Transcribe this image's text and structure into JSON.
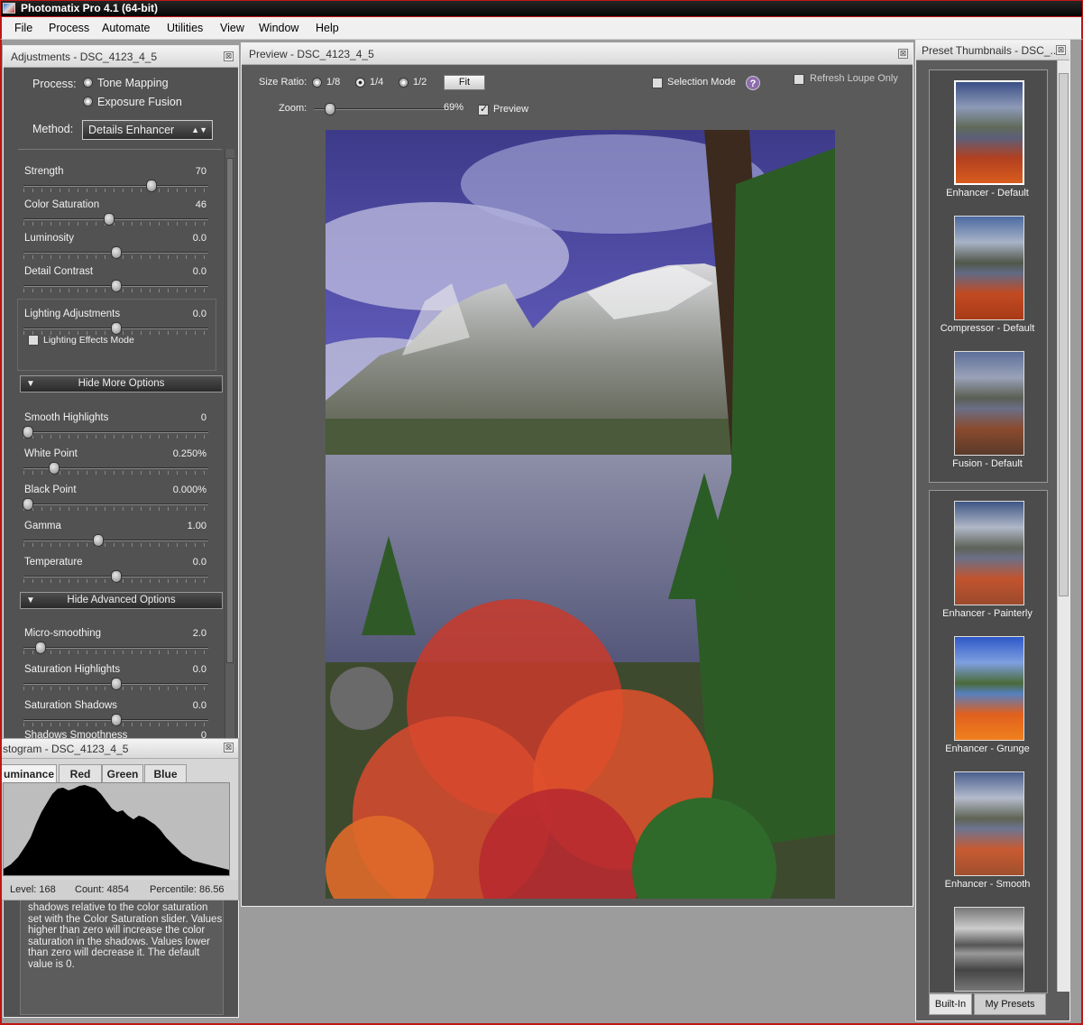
{
  "window": {
    "title": "Photomatix Pro 4.1 (64-bit)"
  },
  "menu": [
    "File",
    "Process",
    "Automate",
    "Utilities",
    "View",
    "Window",
    "Help"
  ],
  "adjustments": {
    "title": "Adjustments - DSC_4123_4_5",
    "process_label": "Process:",
    "process_options": [
      "Tone Mapping",
      "Exposure Fusion"
    ],
    "method_label": "Method:",
    "method_value": "Details Enhancer",
    "sliders": [
      {
        "label": "Strength",
        "value": "70",
        "level": 0.7
      },
      {
        "label": "Color Saturation",
        "value": "46",
        "level": 0.46
      },
      {
        "label": "Luminosity",
        "value": "0.0",
        "level": 0.5
      },
      {
        "label": "Detail Contrast",
        "value": "0.0",
        "level": 0.5
      }
    ],
    "lighting": {
      "label": "Lighting Adjustments",
      "value": "0.0",
      "level": 0.5,
      "checkbox": "Lighting Effects Mode"
    },
    "hide_more": "Hide More Options",
    "more_sliders": [
      {
        "label": "Smooth Highlights",
        "value": "0",
        "level": 0.0
      },
      {
        "label": "White Point",
        "value": "0.250%",
        "level": 0.15
      },
      {
        "label": "Black Point",
        "value": "0.000%",
        "level": 0.0
      },
      {
        "label": "Gamma",
        "value": "1.00",
        "level": 0.4
      },
      {
        "label": "Temperature",
        "value": "0.0",
        "level": 0.5
      }
    ],
    "hide_advanced": "Hide Advanced Options",
    "adv_sliders": [
      {
        "label": "Micro-smoothing",
        "value": "2.0",
        "level": 0.07
      },
      {
        "label": "Saturation Highlights",
        "value": "0.0",
        "level": 0.5
      },
      {
        "label": "Saturation Shadows",
        "value": "0.0",
        "level": 0.5
      }
    ],
    "partial_label": "Shadows Smoothness",
    "partial_value": "0",
    "info_text": [
      "shadows relative to the color saturation",
      "set with the Color Saturation slider. Values",
      "higher than zero will increase the color",
      "saturation in the shadows. Values lower",
      "than zero will decrease it. The default",
      "value is 0."
    ]
  },
  "histogram": {
    "title": "stogram - DSC_4123_4_5",
    "tabs": [
      "uminance",
      "Red",
      "Green",
      "Blue"
    ],
    "level": "Level: 168",
    "count": "Count: 4854",
    "percentile": "Percentile: 86.56"
  },
  "preview": {
    "title": "Preview - DSC_4123_4_5",
    "size_ratio_label": "Size Ratio:",
    "ratios": [
      "1/8",
      "1/4",
      "1/2"
    ],
    "fit": "Fit",
    "selection_mode": "Selection Mode",
    "help": "?",
    "refresh_loupe": "Refresh Loupe Only",
    "zoom_label": "Zoom:",
    "zoom_value": "69%",
    "preview_check": "Preview"
  },
  "presets": {
    "title": "Preset Thumbnails - DSC_...",
    "group1": [
      "Enhancer - Default",
      "Compressor - Default",
      "Fusion - Default"
    ],
    "group2": [
      "Enhancer - Painterly",
      "Enhancer - Grunge",
      "Enhancer - Smooth"
    ],
    "tabs": [
      "Built-In",
      "My Presets"
    ]
  },
  "colors": {
    "frame": "#c01616",
    "panel": "#525252"
  }
}
